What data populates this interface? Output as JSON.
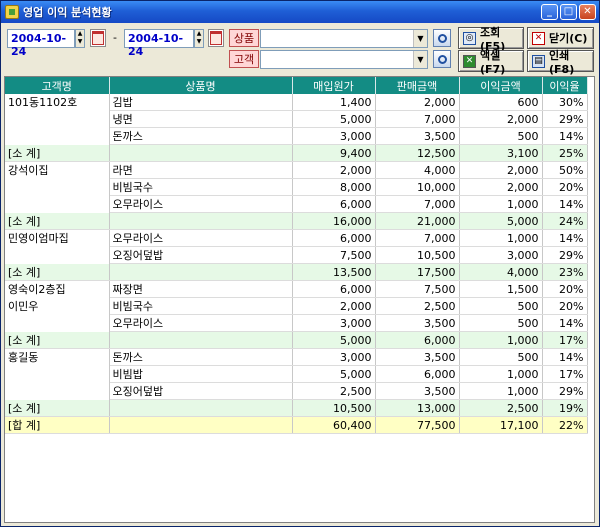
{
  "window": {
    "title": "영업 이익 분석현황",
    "icon": "app-icon"
  },
  "titlebar_buttons": {
    "minimize": "_",
    "maximize": "□",
    "close": "✕"
  },
  "filters": {
    "date_from": "2004-10-24",
    "date_to": "2004-10-24",
    "range_separator": "-",
    "product_label": "상품",
    "product_value": "",
    "customer_label": "고객",
    "customer_value": ""
  },
  "buttons": {
    "search": "조회(F5)",
    "close": "닫기(C)",
    "excel": "액셀(F7)",
    "print": "인쇄(F8)"
  },
  "table": {
    "columns": [
      "고객명",
      "상품명",
      "매입원가",
      "판매금액",
      "이익금액",
      "이익율"
    ],
    "rows": [
      {
        "type": "detail",
        "customer": "101동1102호",
        "product": "김밥",
        "cost": "1,400",
        "sales": "2,000",
        "profit": "600",
        "rate": "30%"
      },
      {
        "type": "detail",
        "customer": "",
        "product": "냉면",
        "cost": "5,000",
        "sales": "7,000",
        "profit": "2,000",
        "rate": "29%"
      },
      {
        "type": "detail",
        "customer": "",
        "product": "돈까스",
        "cost": "3,000",
        "sales": "3,500",
        "profit": "500",
        "rate": "14%"
      },
      {
        "type": "sub",
        "customer": "[소 계]",
        "product": "",
        "cost": "9,400",
        "sales": "12,500",
        "profit": "3,100",
        "rate": "25%"
      },
      {
        "type": "detail",
        "customer": "강석이집",
        "product": "라면",
        "cost": "2,000",
        "sales": "4,000",
        "profit": "2,000",
        "rate": "50%"
      },
      {
        "type": "detail",
        "customer": "",
        "product": "비빔국수",
        "cost": "8,000",
        "sales": "10,000",
        "profit": "2,000",
        "rate": "20%"
      },
      {
        "type": "detail",
        "customer": "",
        "product": "오무라이스",
        "cost": "6,000",
        "sales": "7,000",
        "profit": "1,000",
        "rate": "14%"
      },
      {
        "type": "sub",
        "customer": "[소 계]",
        "product": "",
        "cost": "16,000",
        "sales": "21,000",
        "profit": "5,000",
        "rate": "24%"
      },
      {
        "type": "detail",
        "customer": "민영이엄마집",
        "product": "오무라이스",
        "cost": "6,000",
        "sales": "7,000",
        "profit": "1,000",
        "rate": "14%"
      },
      {
        "type": "detail",
        "customer": "",
        "product": "오징어덮밥",
        "cost": "7,500",
        "sales": "10,500",
        "profit": "3,000",
        "rate": "29%"
      },
      {
        "type": "sub",
        "customer": "[소 계]",
        "product": "",
        "cost": "13,500",
        "sales": "17,500",
        "profit": "4,000",
        "rate": "23%"
      },
      {
        "type": "detail",
        "customer": "영숙이2층집",
        "product": "짜장면",
        "cost": "6,000",
        "sales": "7,500",
        "profit": "1,500",
        "rate": "20%"
      },
      {
        "type": "detail",
        "customer": "이민우",
        "product": "비빔국수",
        "cost": "2,000",
        "sales": "2,500",
        "profit": "500",
        "rate": "20%"
      },
      {
        "type": "detail",
        "customer": "",
        "product": "오무라이스",
        "cost": "3,000",
        "sales": "3,500",
        "profit": "500",
        "rate": "14%"
      },
      {
        "type": "sub",
        "customer": "[소 계]",
        "product": "",
        "cost": "5,000",
        "sales": "6,000",
        "profit": "1,000",
        "rate": "17%"
      },
      {
        "type": "detail",
        "customer": "홍길동",
        "product": "돈까스",
        "cost": "3,000",
        "sales": "3,500",
        "profit": "500",
        "rate": "14%"
      },
      {
        "type": "detail",
        "customer": "",
        "product": "비빔밥",
        "cost": "5,000",
        "sales": "6,000",
        "profit": "1,000",
        "rate": "17%"
      },
      {
        "type": "detail",
        "customer": "",
        "product": "오징어덮밥",
        "cost": "2,500",
        "sales": "3,500",
        "profit": "1,000",
        "rate": "29%"
      },
      {
        "type": "sub",
        "customer": "[소 계]",
        "product": "",
        "cost": "10,500",
        "sales": "13,000",
        "profit": "2,500",
        "rate": "19%"
      },
      {
        "type": "total",
        "customer": "[합 계]",
        "product": "",
        "cost": "60,400",
        "sales": "77,500",
        "profit": "17,100",
        "rate": "22%"
      }
    ]
  },
  "colors": {
    "header_bg": "#138c84",
    "subtotal_bg": "#e6f9e6",
    "total_bg": "#ffffc4",
    "label_bg": "#ffd6d6"
  }
}
